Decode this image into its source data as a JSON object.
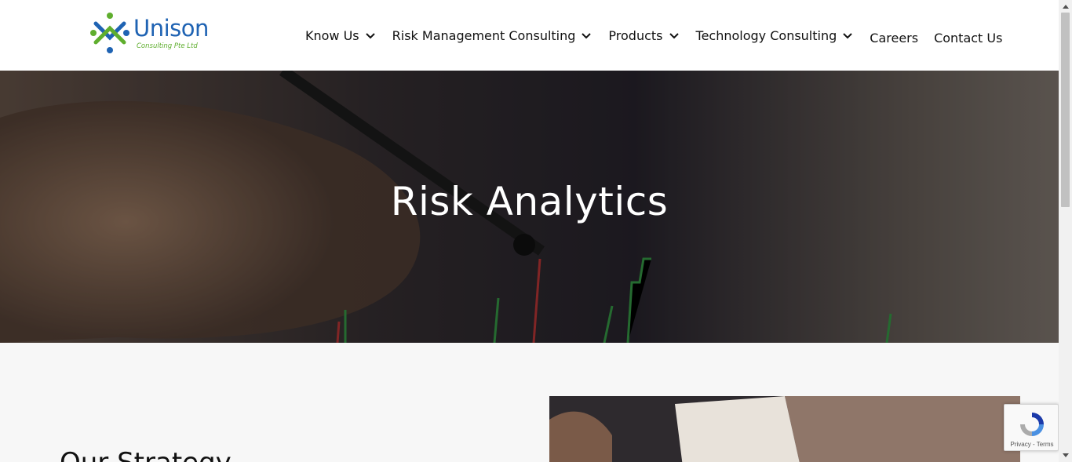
{
  "brand": {
    "name": "Unison",
    "tagline": "Consulting Pte Ltd"
  },
  "nav": {
    "items": [
      {
        "label": "Know Us",
        "has_dropdown": true
      },
      {
        "label": "Risk Management Consulting",
        "has_dropdown": true
      },
      {
        "label": "Products",
        "has_dropdown": true
      },
      {
        "label": "Technology Consulting",
        "has_dropdown": true
      },
      {
        "label": "Careers",
        "has_dropdown": false
      },
      {
        "label": "Contact Us",
        "has_dropdown": false
      }
    ]
  },
  "hero": {
    "title": "Risk Analytics"
  },
  "section": {
    "title": "Our Strategy"
  },
  "recaptcha": {
    "links": "Privacy - Terms"
  },
  "icons": {
    "dropdown": "chevron-down-icon",
    "recaptcha": "recaptcha-icon"
  },
  "colors": {
    "brand_blue": "#1f63b3",
    "brand_green": "#5fae2e"
  }
}
